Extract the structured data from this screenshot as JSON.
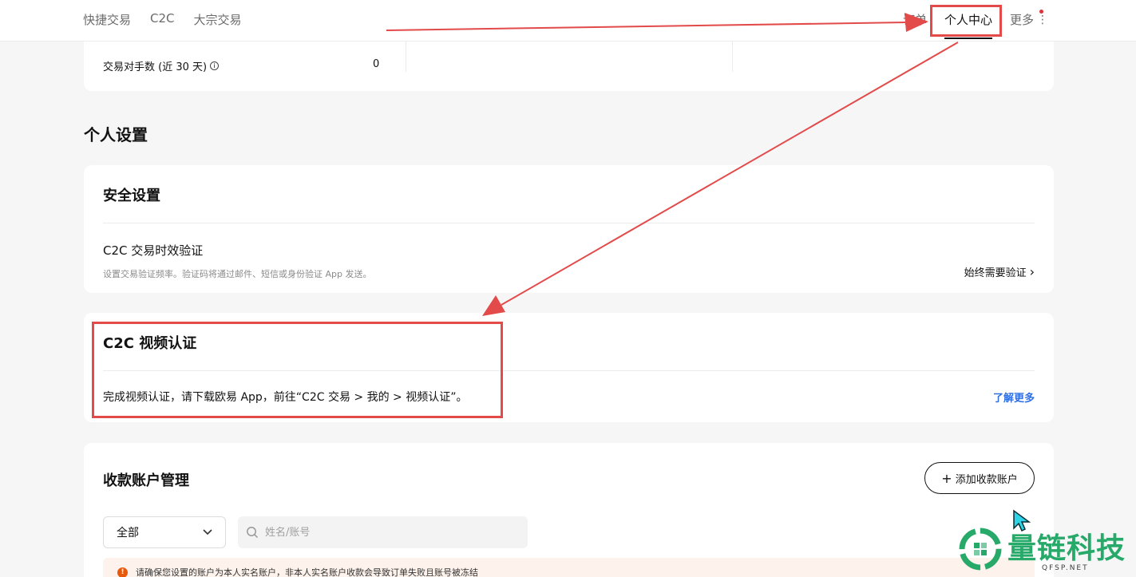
{
  "nav": {
    "left": [
      "快捷交易",
      "C2C",
      "大宗交易"
    ],
    "orders": "订单",
    "personal_center": "个人中心",
    "more": "更多",
    "kebab": "⋮"
  },
  "stats": {
    "counterparties_label": "交易对手数 (近 30 天)",
    "info": "i",
    "counterparties_value": "0"
  },
  "section_title": "个人设置",
  "security": {
    "title": "安全设置",
    "row_title": "C2C 交易时效验证",
    "row_desc": "设置交易验证频率。验证码将通过邮件、短信或身份验证 App 发送。",
    "action": "始终需要验证",
    "chevron": "›"
  },
  "video": {
    "title": "C2C 视频认证",
    "desc": "完成视频认证，请下载欧易 App，前往“C2C 交易 > 我的 > 视频认证”。",
    "learn_more": "了解更多"
  },
  "payment": {
    "title": "收款账户管理",
    "add_button": "添加收款账户",
    "plus": "+",
    "filter_value": "全部",
    "search_placeholder": "姓名/账号",
    "warning_icon": "!",
    "warning": "请确保您设置的账户为本人实名账户，非本人实名账户收款会导致订单失败且账号被冻结"
  },
  "watermark": {
    "text": "量链科技",
    "sub": "QFSP.NET"
  },
  "colors": {
    "annotation_red": "#e34a4a",
    "link_blue": "#2f6fe4",
    "watermark_green": "#27a96a",
    "cursor_cyan": "#2dd4e8"
  },
  "icons": [
    "info-icon",
    "chevron-right-icon",
    "chevron-down-icon",
    "search-icon",
    "plus-icon",
    "warning-icon",
    "cursor-icon",
    "watermark-logo-icon"
  ]
}
